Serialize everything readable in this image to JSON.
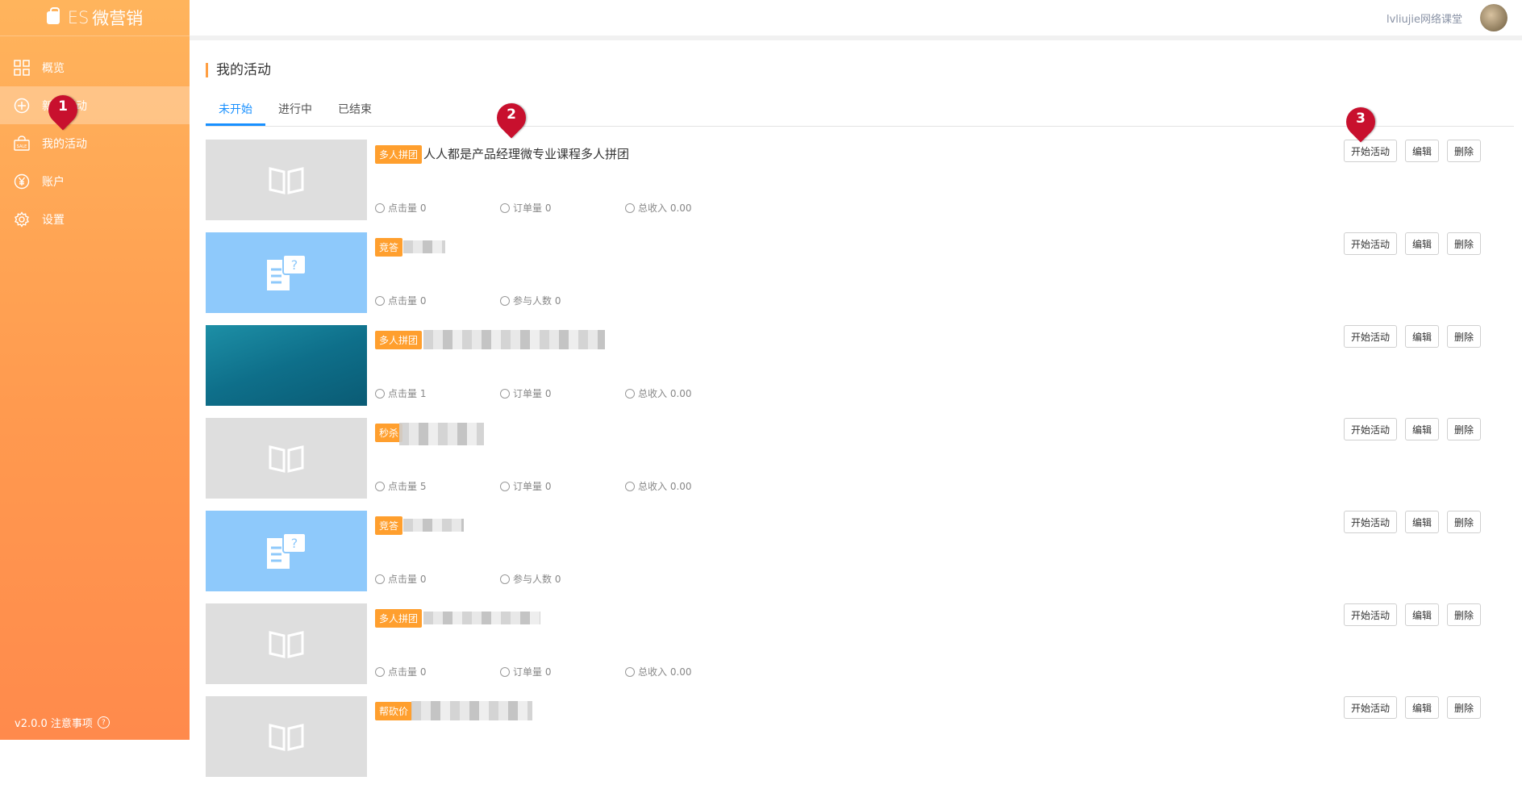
{
  "brand": {
    "prefix": "ES",
    "name": "微营销"
  },
  "sidebar": {
    "items": [
      {
        "label": "概览",
        "icon": "grid-icon"
      },
      {
        "label": "新建活动",
        "icon": "plus-circle-icon"
      },
      {
        "label": "我的活动",
        "icon": "sale-bag-icon"
      },
      {
        "label": "账户",
        "icon": "yen-icon"
      },
      {
        "label": "设置",
        "icon": "gear-icon"
      }
    ],
    "version": "v2.0.0 注意事项",
    "help_glyph": "?"
  },
  "header": {
    "username": "lvliujie网络课堂"
  },
  "page": {
    "title": "我的活动"
  },
  "tabs": [
    {
      "label": "未开始"
    },
    {
      "label": "进行中"
    },
    {
      "label": "已结束"
    }
  ],
  "actions": {
    "start": "开始活动",
    "edit": "编辑",
    "delete": "删除"
  },
  "activities": [
    {
      "tag": "多人拼团",
      "title": "人人都是产品经理微专业课程多人拼团",
      "clicks": "点击量 0",
      "orders": "订单量 0",
      "income": "总收入 0.00"
    },
    {
      "tag": "竞答",
      "title": "",
      "clicks": "点击量 0",
      "participants": "参与人数 0"
    },
    {
      "tag": "多人拼团",
      "title": "",
      "clicks": "点击量 1",
      "orders": "订单量 0",
      "income": "总收入 0.00"
    },
    {
      "tag": "秒杀",
      "title": "",
      "clicks": "点击量 5",
      "orders": "订单量 0",
      "income": "总收入 0.00"
    },
    {
      "tag": "竞答",
      "title": "",
      "clicks": "点击量 0",
      "participants": "参与人数 0"
    },
    {
      "tag": "多人拼团",
      "title": "",
      "clicks": "点击量 0",
      "orders": "订单量 0",
      "income": "总收入 0.00"
    },
    {
      "tag": "帮砍价",
      "title": ""
    }
  ],
  "markers": [
    "1",
    "2",
    "3"
  ],
  "colors": {
    "accent": "#ff9f43",
    "tab_active": "#1890ff",
    "marker": "#c8102e"
  }
}
